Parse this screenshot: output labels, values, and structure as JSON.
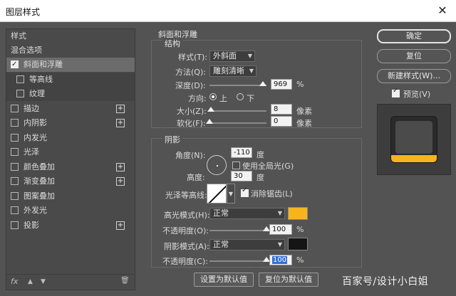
{
  "window": {
    "title": "图层样式",
    "close": "✕"
  },
  "left_panel": {
    "header": "样式",
    "blend": "混合选项",
    "items": [
      {
        "label": "斜面和浮雕",
        "checked": true,
        "selected": true,
        "plus": false
      },
      {
        "label": "等高线",
        "checked": false,
        "sub": true,
        "plus": false
      },
      {
        "label": "纹理",
        "checked": false,
        "sub": true,
        "plus": false
      },
      {
        "label": "描边",
        "checked": false,
        "plus": true
      },
      {
        "label": "内阴影",
        "checked": false,
        "plus": true
      },
      {
        "label": "内发光",
        "checked": false,
        "plus": false
      },
      {
        "label": "光泽",
        "checked": false,
        "plus": false
      },
      {
        "label": "颜色叠加",
        "checked": false,
        "plus": true
      },
      {
        "label": "渐变叠加",
        "checked": false,
        "plus": true
      },
      {
        "label": "图案叠加",
        "checked": false,
        "plus": false
      },
      {
        "label": "外发光",
        "checked": false,
        "plus": false
      },
      {
        "label": "投影",
        "checked": false,
        "plus": true
      }
    ],
    "footer": {
      "fx": "fx",
      "up": "▲",
      "down": "▼",
      "trash": "🗑"
    }
  },
  "bevel": {
    "section_title": "斜面和浮雕",
    "structure_title": "结构",
    "style_label": "样式(T):",
    "style_value": "外斜面",
    "method_label": "方法(Q):",
    "method_value": "雕刻清晰",
    "depth_label": "深度(D):",
    "depth_value": "969",
    "depth_unit": "%",
    "depth_level": 0.94,
    "direction_label": "方向:",
    "dir_up": "上",
    "dir_down": "下",
    "size_label": "大小(Z):",
    "size_value": "8",
    "size_unit": "像素",
    "size_level": 0.03,
    "soften_label": "软化(F):",
    "soften_value": "0",
    "soften_unit": "像素",
    "soften_level": 0.0
  },
  "shading": {
    "title": "阴影",
    "angle_label": "角度(N):",
    "angle_value": "-110",
    "angle_unit": "度",
    "global_light_label": "使用全局光(G)",
    "altitude_label": "高度:",
    "altitude_value": "30",
    "altitude_unit": "度",
    "gloss_label": "光泽等高线:",
    "antialias_label": "消除锯齿(L)",
    "highlight_label": "高光模式(H):",
    "highlight_value": "正常",
    "highlight_color": "#f5b51d",
    "hl_opacity_label": "不透明度(O):",
    "hl_opacity_value": "100",
    "hl_opacity_unit": "%",
    "hl_opacity_level": 1.0,
    "shadow_label": "阴影模式(A):",
    "shadow_value": "正常",
    "shadow_color": "#151515",
    "sh_opacity_label": "不透明度(C):",
    "sh_opacity_value": "100",
    "sh_opacity_unit": "%",
    "sh_opacity_level": 1.0
  },
  "bottom_buttons": {
    "set_default": "设置为默认值",
    "reset_default": "复位为默认值"
  },
  "right_buttons": {
    "ok": "确定",
    "reset": "复位",
    "new_style": "新建样式(W)...",
    "preview_label": "预览(V)"
  },
  "watermark": "百家号/设计小白姐"
}
